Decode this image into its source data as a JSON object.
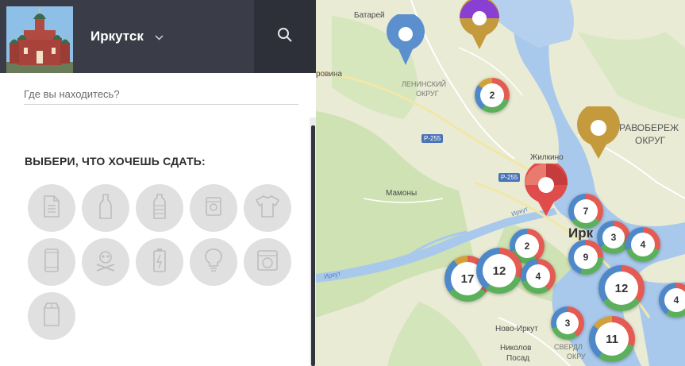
{
  "header": {
    "city": "Иркутск",
    "logo_icon": "cathedral-logo-icon",
    "search_icon": "search-icon",
    "chevron_icon": "chevron-down-icon"
  },
  "location": {
    "placeholder": "Где вы находитесь?"
  },
  "section": {
    "title": "ВЫБЕРИ, ЧТО ХОЧЕШЬ СДАТЬ:"
  },
  "categories": [
    {
      "icon": "paper-icon"
    },
    {
      "icon": "glass-bottle-icon"
    },
    {
      "icon": "plastic-bottle-icon"
    },
    {
      "icon": "metal-can-icon"
    },
    {
      "icon": "clothes-icon"
    },
    {
      "icon": "phone-icon"
    },
    {
      "icon": "hazardous-icon"
    },
    {
      "icon": "battery-icon"
    },
    {
      "icon": "lightbulb-icon"
    },
    {
      "icon": "appliance-icon"
    },
    {
      "icon": "tetrapak-icon"
    }
  ],
  "map": {
    "labels": {
      "batareynaya": "Батарей",
      "olkhovina": "ровина",
      "leninsky": "ЛЕНИНСКИЙ",
      "okrug1": "ОКРУГ",
      "pravoberezhny": "РАВОБЕРЕЖ",
      "okrug2": "ОКРУГ",
      "zhilkino": "Жилкино",
      "mamony": "Мамоны",
      "irkutsk": "Ирк",
      "irkut": "Иркут",
      "novo_irkutsky": "Ново-Иркут",
      "nikolov": "Николов",
      "posad": "Посад",
      "sverdl": "СВЕРДЛ",
      "okr3": "ОКРУ",
      "r255a": "Р-255",
      "r255b": "Р-255",
      "irkut2": "Иркут"
    },
    "clusters": [
      {
        "count": "2"
      },
      {
        "count": "7"
      },
      {
        "count": "2"
      },
      {
        "count": "3"
      },
      {
        "count": "4"
      },
      {
        "count": "9"
      },
      {
        "count": "17"
      },
      {
        "count": "12"
      },
      {
        "count": "4"
      },
      {
        "count": "12"
      },
      {
        "count": "4"
      },
      {
        "count": "3"
      },
      {
        "count": "11"
      }
    ]
  },
  "colors": {
    "header_bg": "#3a3d48",
    "search_bg": "#2e3039",
    "water": "#a9c9ec",
    "park": "#c9dfae",
    "pin_blue": "#5b8fce",
    "pin_gold": "#c59a3d",
    "pin_purple": "#8a3fd3",
    "pin_red": "#e04b4b",
    "ring_red": "#e35b52",
    "ring_green": "#5cb05c",
    "ring_blue": "#4f88c9",
    "ring_gold": "#d3a13c"
  }
}
